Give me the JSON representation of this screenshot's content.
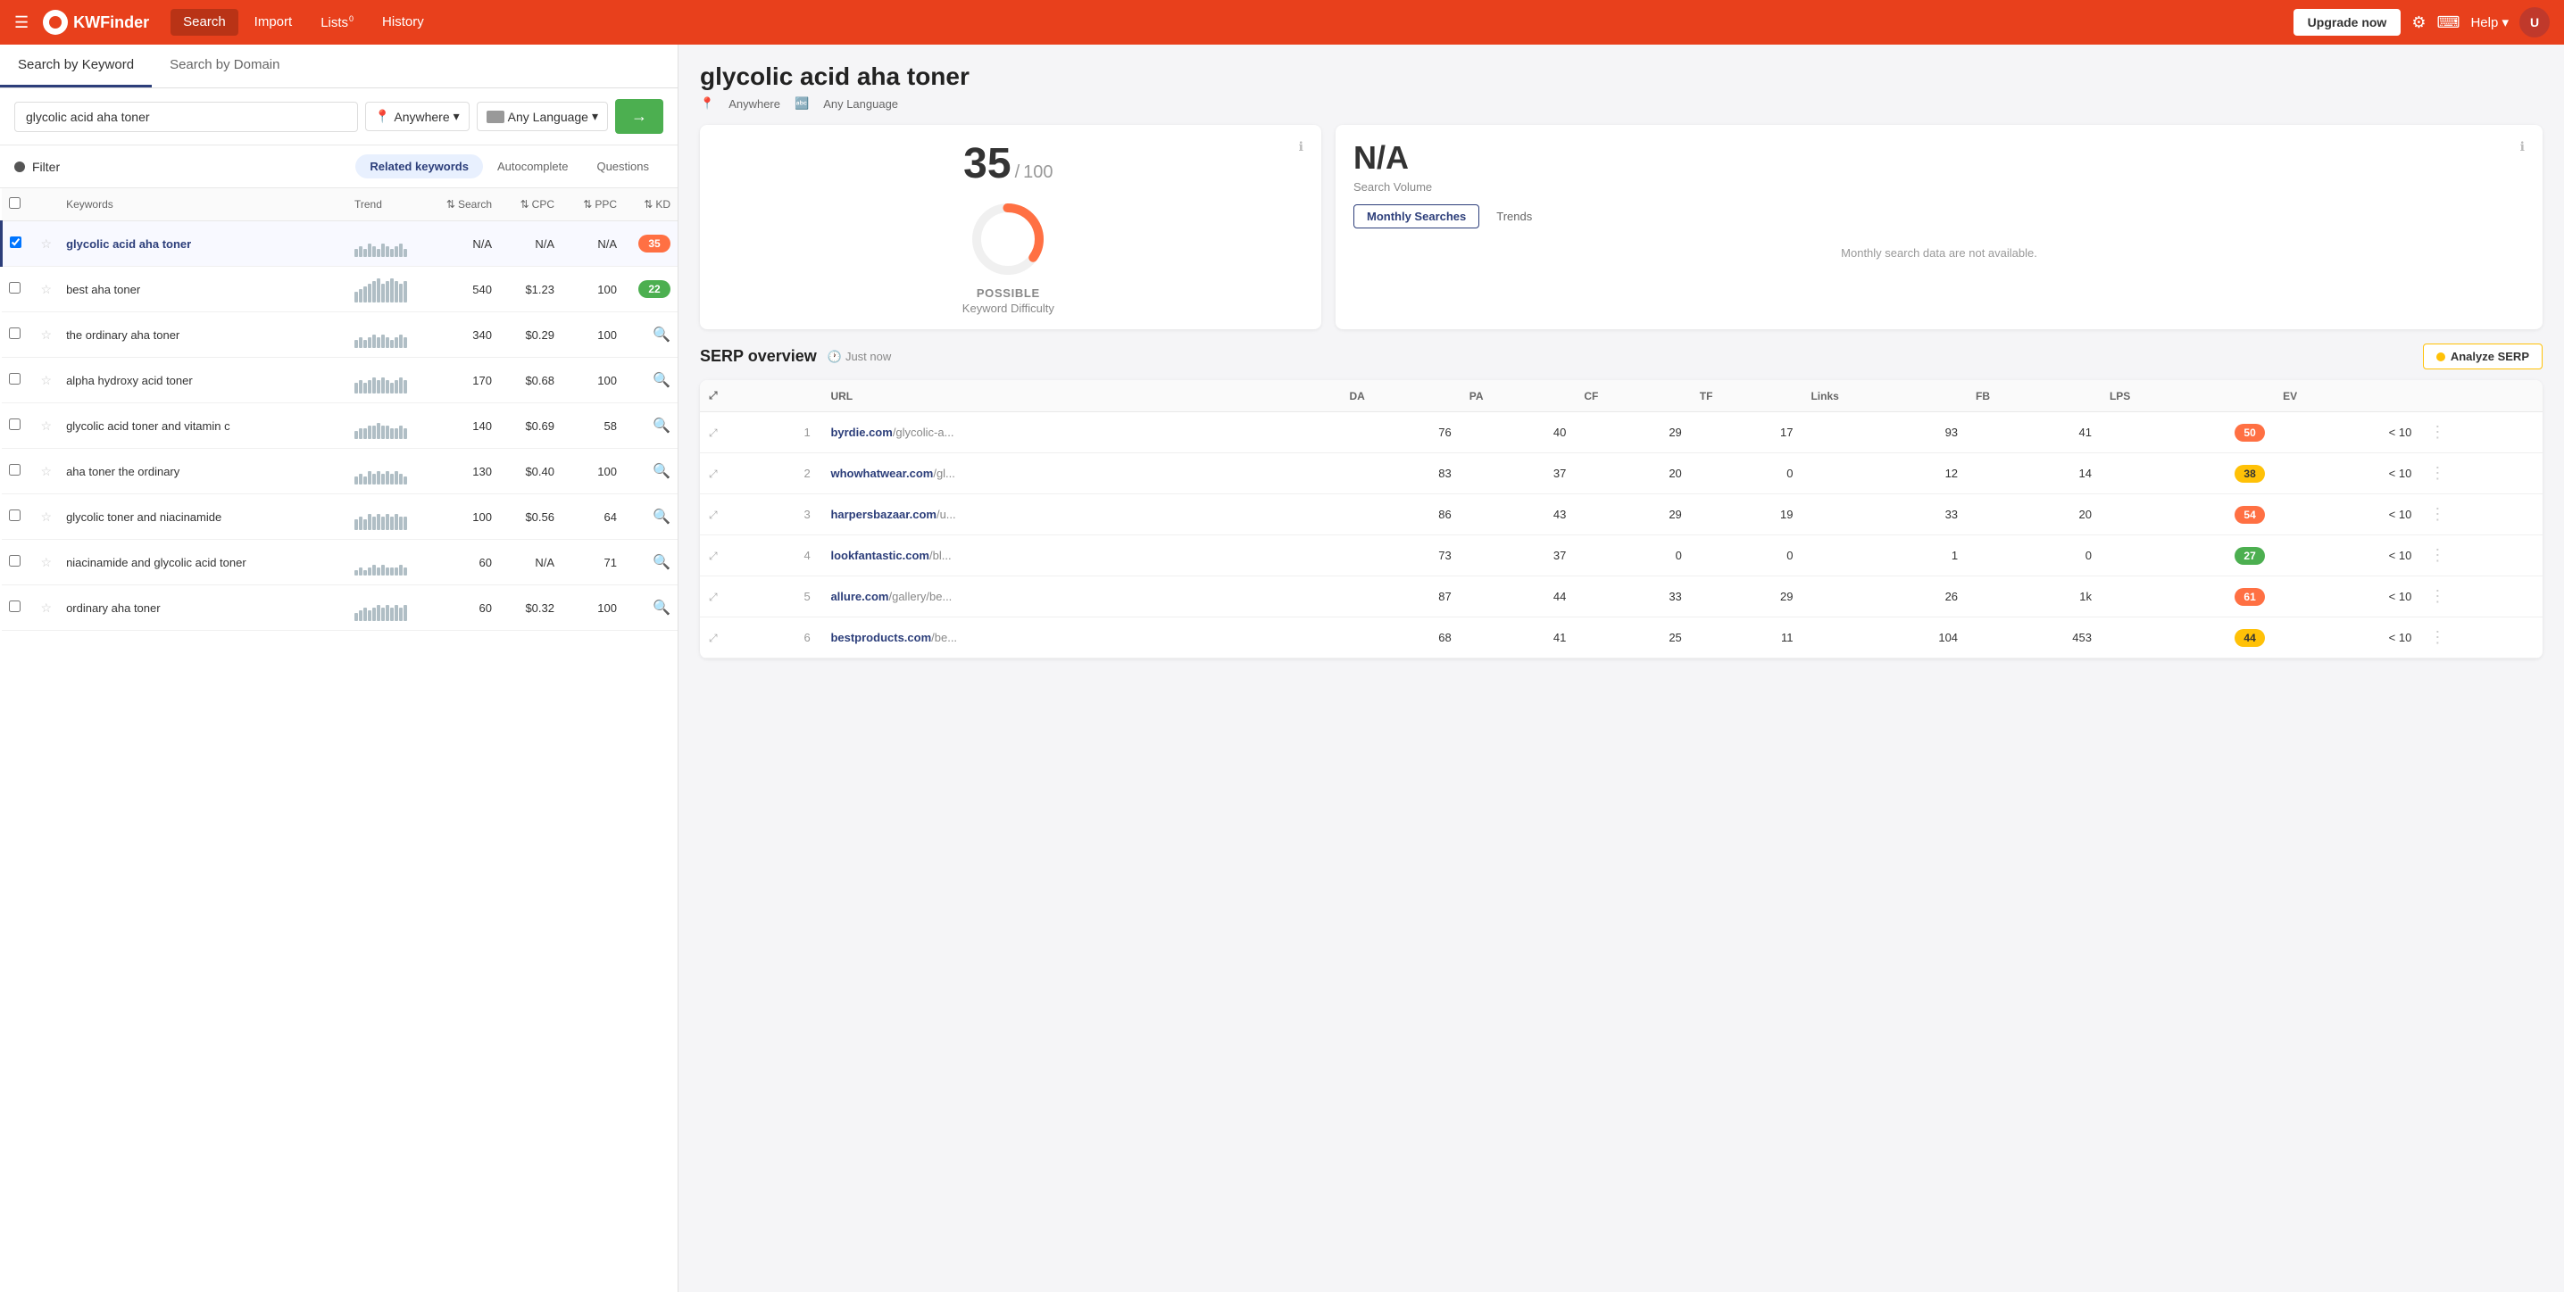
{
  "app": {
    "name": "KWFinder",
    "nav": [
      {
        "label": "Search",
        "active": true
      },
      {
        "label": "Import"
      },
      {
        "label": "Lists",
        "badge": "0"
      },
      {
        "label": "History"
      }
    ],
    "upgrade_btn": "Upgrade now",
    "help_label": "Help"
  },
  "search": {
    "tabs": [
      {
        "label": "Search by Keyword",
        "active": true
      },
      {
        "label": "Search by Domain"
      }
    ],
    "query": "glycolic acid aha toner",
    "location": "Anywhere",
    "language": "Any Language",
    "go_btn": "→",
    "filter_label": "Filter",
    "keyword_types": [
      {
        "label": "Related keywords",
        "active": true
      },
      {
        "label": "Autocomplete"
      },
      {
        "label": "Questions"
      }
    ],
    "columns": [
      "Keywords",
      "Trend",
      "Search",
      "CPC",
      "PPC",
      "KD"
    ]
  },
  "keywords": [
    {
      "name": "glycolic acid aha toner",
      "bold": true,
      "trend_bars": [
        3,
        4,
        3,
        5,
        4,
        3,
        5,
        4,
        3,
        4,
        5,
        3
      ],
      "search": "N/A",
      "cpc": "N/A",
      "ppc": "N/A",
      "kd": 35,
      "kd_color": "orange",
      "selected": true
    },
    {
      "name": "best aha toner",
      "bold": false,
      "trend_bars": [
        4,
        5,
        6,
        7,
        8,
        9,
        7,
        8,
        9,
        8,
        7,
        8
      ],
      "search": "540",
      "cpc": "$1.23",
      "ppc": "100",
      "kd": 22,
      "kd_color": "green"
    },
    {
      "name": "the ordinary aha toner",
      "bold": false,
      "trend_bars": [
        3,
        4,
        3,
        4,
        5,
        4,
        5,
        4,
        3,
        4,
        5,
        4
      ],
      "search": "340",
      "cpc": "$0.29",
      "ppc": "100",
      "kd": null,
      "kd_color": "search"
    },
    {
      "name": "alpha hydroxy acid toner",
      "bold": false,
      "trend_bars": [
        4,
        5,
        4,
        5,
        6,
        5,
        6,
        5,
        4,
        5,
        6,
        5
      ],
      "search": "170",
      "cpc": "$0.68",
      "ppc": "100",
      "kd": null,
      "kd_color": "search"
    },
    {
      "name": "glycolic acid toner and vitamin c",
      "bold": false,
      "trend_bars": [
        3,
        4,
        4,
        5,
        5,
        6,
        5,
        5,
        4,
        4,
        5,
        4
      ],
      "search": "140",
      "cpc": "$0.69",
      "ppc": "58",
      "kd": null,
      "kd_color": "search"
    },
    {
      "name": "aha toner the ordinary",
      "bold": false,
      "trend_bars": [
        3,
        4,
        3,
        5,
        4,
        5,
        4,
        5,
        4,
        5,
        4,
        3
      ],
      "search": "130",
      "cpc": "$0.40",
      "ppc": "100",
      "kd": null,
      "kd_color": "search"
    },
    {
      "name": "glycolic toner and niacinamide",
      "bold": false,
      "trend_bars": [
        4,
        5,
        4,
        6,
        5,
        6,
        5,
        6,
        5,
        6,
        5,
        5
      ],
      "search": "100",
      "cpc": "$0.56",
      "ppc": "64",
      "kd": null,
      "kd_color": "search"
    },
    {
      "name": "niacinamide and glycolic acid toner",
      "bold": false,
      "trend_bars": [
        2,
        3,
        2,
        3,
        4,
        3,
        4,
        3,
        3,
        3,
        4,
        3
      ],
      "search": "60",
      "cpc": "N/A",
      "ppc": "71",
      "kd": null,
      "kd_color": "search"
    },
    {
      "name": "ordinary aha toner",
      "bold": false,
      "trend_bars": [
        3,
        4,
        5,
        4,
        5,
        6,
        5,
        6,
        5,
        6,
        5,
        6
      ],
      "search": "60",
      "cpc": "$0.32",
      "ppc": "100",
      "kd": null,
      "kd_color": "search"
    }
  ],
  "detail": {
    "keyword": "glycolic acid aha toner",
    "location": "Anywhere",
    "language": "Any Language",
    "kd": {
      "score": 35,
      "max": 100,
      "label": "POSSIBLE",
      "sublabel": "Keyword Difficulty",
      "donut_pct": 35,
      "color": "#ff7043"
    },
    "volume": {
      "value": "N/A",
      "sublabel": "Search Volume",
      "no_data_msg": "Monthly search data are not available.",
      "tabs": [
        {
          "label": "Monthly Searches",
          "active": true
        },
        {
          "label": "Trends"
        }
      ]
    },
    "serp": {
      "title": "SERP overview",
      "time": "Just now",
      "analyze_btn": "Analyze SERP",
      "columns": [
        "",
        "URL",
        "DA",
        "PA",
        "CF",
        "TF",
        "Links",
        "FB",
        "LPS",
        "EV"
      ],
      "rows": [
        {
          "rank": 1,
          "domain": "byrdie.com",
          "path": "/glycolic-a...",
          "da": 76,
          "pa": 40,
          "cf": 29,
          "tf": 17,
          "links": 93,
          "fb": 41,
          "lps": 50,
          "lps_color": "orange",
          "ev": "< 10"
        },
        {
          "rank": 2,
          "domain": "whowhatwear.com",
          "path": "/gl...",
          "da": 83,
          "pa": 37,
          "cf": 20,
          "tf": 0,
          "links": 12,
          "fb": 14,
          "lps": 38,
          "lps_color": "yellow",
          "ev": "< 10"
        },
        {
          "rank": 3,
          "domain": "harpersbazaar.com",
          "path": "/u...",
          "da": 86,
          "pa": 43,
          "cf": 29,
          "tf": 19,
          "links": 33,
          "fb": 20,
          "lps": 54,
          "lps_color": "orange",
          "ev": "< 10"
        },
        {
          "rank": 4,
          "domain": "lookfantastic.com",
          "path": "/bl...",
          "da": 73,
          "pa": 37,
          "cf": 0,
          "tf": 0,
          "links": 1,
          "fb": 0,
          "lps": 27,
          "lps_color": "green",
          "ev": "< 10"
        },
        {
          "rank": 5,
          "domain": "allure.com",
          "path": "/gallery/be...",
          "da": 87,
          "pa": 44,
          "cf": 33,
          "tf": 29,
          "links": 26,
          "fb": "1k",
          "lps": 61,
          "lps_color": "orange",
          "ev": "< 10"
        },
        {
          "rank": 6,
          "domain": "bestproducts.com",
          "path": "/be...",
          "da": 68,
          "pa": 41,
          "cf": 25,
          "tf": 11,
          "links": 104,
          "fb": 453,
          "lps": 44,
          "lps_color": "yellow",
          "ev": "< 10"
        }
      ]
    }
  }
}
